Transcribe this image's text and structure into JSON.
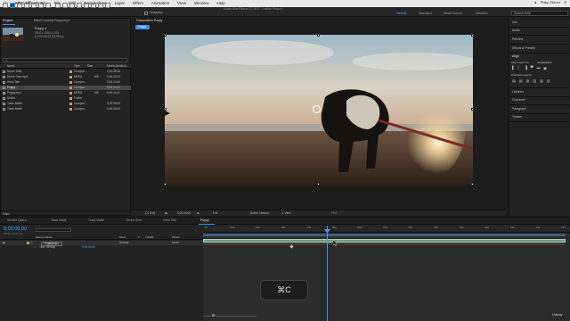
{
  "menubar": {
    "app": "After Effects CC",
    "items": [
      "File",
      "Edit",
      "Composition",
      "Layer",
      "Effect",
      "Animation",
      "View",
      "Window",
      "Help"
    ],
    "user": "Philip Ebiner",
    "title": "Adobe After Effects CC 2017 - Untitled Project *"
  },
  "toolbar": {
    "snapping": "Snapping",
    "workspaces": [
      "Default",
      "Standard",
      "Small Screen",
      "Libraries"
    ],
    "active_workspace": "Default",
    "search_placeholder": "Search Help"
  },
  "project": {
    "tab": "Project",
    "effect_tab": "Effect Controls Puppy.mp4",
    "selected_name": "Puppy ▾",
    "selected_meta1": "1920 x 1080 (1.00)",
    "selected_meta2": "Δ 0;00;15;13, 23.98 fps",
    "search_placeholder": "",
    "columns": [
      "Name",
      "Type",
      "Size",
      "Media Duration"
    ],
    "rows": [
      {
        "name": "Drone Shot",
        "type": "Compos…",
        "size": "",
        "dur": "0;00;05;00",
        "color": "#b0a45a",
        "sel": false
      },
      {
        "name": "Drone Shot.mp4",
        "type": "MPEG",
        "size": "MB",
        "dur": "0;00;29;12",
        "color": "#b0a45a",
        "sel": false
      },
      {
        "name": "Hello Title",
        "type": "Compos…",
        "size": "",
        "dur": "0;00;10;00",
        "color": "#b0a45a",
        "sel": false
      },
      {
        "name": "Puppy",
        "type": "Compos…",
        "size": "",
        "dur": "0;00;14;11",
        "color": "#b0a45a",
        "sel": true
      },
      {
        "name": "Puppy.mp4",
        "type": "MPEG",
        "size": "MB",
        "dur": "0;00;14;11",
        "color": "#b0a45a",
        "sel": false
      },
      {
        "name": "Solids",
        "type": "Folder",
        "size": "",
        "dur": "",
        "color": "#c9a54e",
        "sel": false
      },
      {
        "name": "Track Matte",
        "type": "Compos…",
        "size": "",
        "dur": "0;00;05;00",
        "color": "#b0a45a",
        "sel": false
      },
      {
        "name": "Track Matte",
        "type": "Compos…",
        "size": "",
        "dur": "0;00;05;00",
        "color": "#b0a45a",
        "sel": false
      }
    ],
    "bpc": "8 bpc"
  },
  "viewer": {
    "tab": "Composition Puppy",
    "comp_chip": "Puppy",
    "zoom": "(71.9%)",
    "timecode": "0;00;03;00",
    "resolution": "Full",
    "camera": "Active Camera",
    "views": "1 View",
    "exposure": "+0.0"
  },
  "right_panel": {
    "items": [
      "Info",
      "Audio",
      "Preview",
      "Effects & Presets",
      "Align",
      "Align Layers to:",
      "Composition",
      "Distribute Layers:",
      "Libraries",
      "Character",
      "Paragraph",
      "Tracker"
    ]
  },
  "timeline": {
    "tabs": [
      "Render Queue",
      "Track Matte",
      "Track Matte",
      "Drone Shot",
      "Hello Title",
      "Puppy"
    ],
    "active_tab": "Puppy",
    "timecode": "0;00;05;00",
    "fps_note": "00150 (29.97 fps)",
    "col_headers": [
      "Source Name",
      "Mode",
      "T",
      "TrkMat",
      "Parent"
    ],
    "layer": {
      "num": "1",
      "name": "Puppy.mp4",
      "mode": "Normal",
      "parent": "None"
    },
    "sub": "Time Remap",
    "sub_value": "0;00;05;00",
    "ruler": [
      "0f",
      "01s",
      "02s",
      "03s",
      "04s",
      "05s",
      "06s",
      "07s",
      "08s",
      "09s",
      "10s",
      "11s",
      "12s",
      "13s",
      "14s"
    ]
  },
  "overlay": {
    "shortcut": "⌘C"
  },
  "brand": "Udemy",
  "colors": {
    "accent": "#3d8ee6",
    "track": "#6f9b7d",
    "label_yellow": "#b0a45a"
  }
}
